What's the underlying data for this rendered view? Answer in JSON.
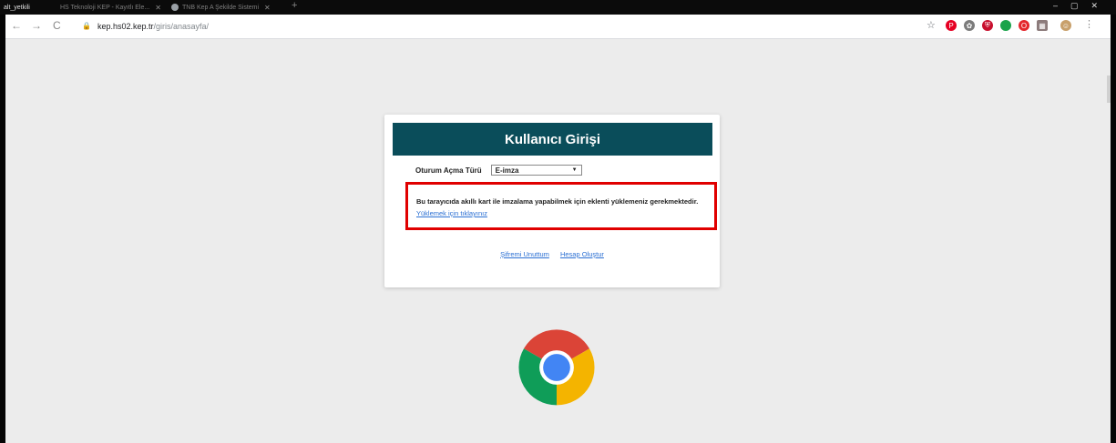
{
  "tabs": [
    {
      "label": "alt_yetkili",
      "active": true
    },
    {
      "label": "HS Teknoloji KEP - Kayıtlı Ele..."
    },
    {
      "label": "TNB Kep A Şekilde Sistemi"
    }
  ],
  "toolbar": {
    "url_host": "kep.hs02.kep.tr",
    "url_path": "/giris/anasayfa/"
  },
  "extensions": [
    {
      "icon": "pinterest-icon",
      "color": "#e60023",
      "glyph": "P"
    },
    {
      "icon": "puzzle-icon",
      "color": "#7b7b7b",
      "glyph": "✿"
    },
    {
      "icon": "shield-icon",
      "color": "#c8102e",
      "glyph": "⛨"
    },
    {
      "icon": "green-dot-icon",
      "color": "#1aa34a",
      "glyph": ""
    },
    {
      "icon": "opera-icon",
      "color": "#e4262b",
      "glyph": "O"
    },
    {
      "icon": "grid-icon",
      "color": "#8c7b7b",
      "glyph": "▦"
    },
    {
      "icon": "avatar-icon",
      "color": "#c8a06b",
      "glyph": "☺"
    }
  ],
  "login": {
    "title": "Kullanıcı Girişi",
    "session_type_label": "Oturum Açma Türü",
    "session_type_value": "E-imza",
    "notice": "Bu tarayıcıda akıllı kart ile imzalama yapabilmek için eklenti yüklemeniz gerekmektedir.",
    "install_link": "Yüklemek için tıklayınız",
    "forgot_password": "Şifremi Unuttum",
    "create_account": "Hesap Oluştur"
  },
  "colors": {
    "header_bg": "#0a4d5a",
    "highlight_border": "#e00000",
    "link": "#2a6fd3"
  }
}
